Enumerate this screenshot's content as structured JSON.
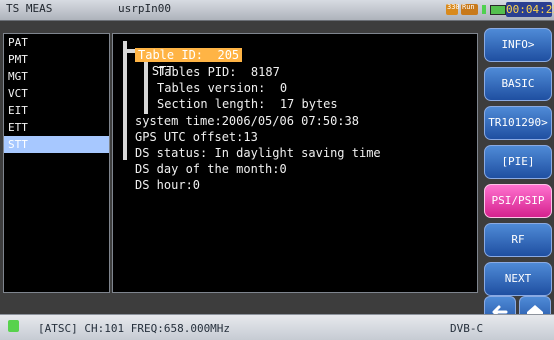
{
  "header": {
    "mode": "TS MEAS",
    "file_name": "usrpIn00",
    "status_badges": {
      "left": "330",
      "right": "Run"
    },
    "time": "00:04:25"
  },
  "left_panel": {
    "items": [
      "PAT",
      "PMT",
      "MGT",
      "VCT",
      "EIT",
      "ETT",
      "STT"
    ],
    "selected_index": 6
  },
  "tree": {
    "root": "STT",
    "table_id": "Table ID:  205",
    "lines": [
      "Tables PID:  8187",
      "Tables version:  0",
      "Section length:  17 bytes",
      "system time:2006/05/06 07:50:38",
      "GPS UTC offset:13",
      "DS status: In daylight saving time",
      "DS day of the month:0",
      "DS hour:0"
    ]
  },
  "right_menu": {
    "buttons": [
      "INFO>",
      "BASIC",
      "TR101290>",
      "[PIE]",
      "PSI/PSIP",
      "RF",
      "NEXT"
    ],
    "active": "PSI/PSIP",
    "icons": [
      "arrow-left-icon",
      "home-icon"
    ]
  },
  "footer": {
    "info": "[ATSC]  CH:101  FREQ:658.000MHz",
    "mode": "DVB-C"
  },
  "colors": {
    "accent": "#ffb445",
    "selected": "#a7c8ff",
    "active_button": "#e23b9c",
    "button": "#2f63bf"
  }
}
